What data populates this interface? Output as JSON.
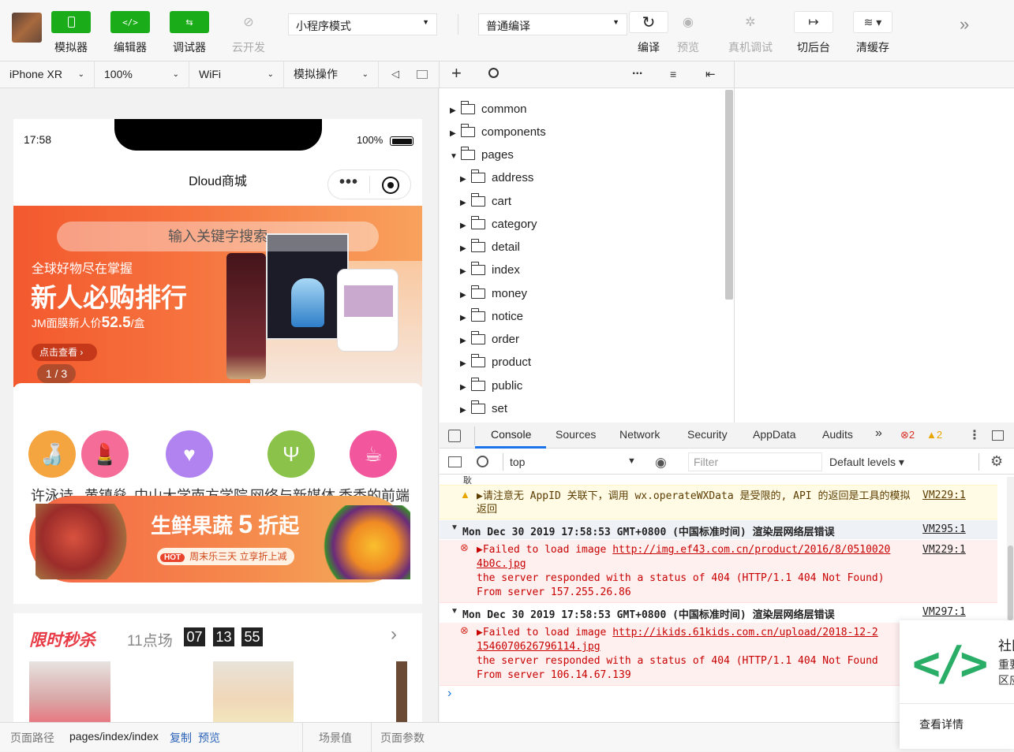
{
  "toolbar": {
    "buttons": [
      {
        "icon": "phone-icon",
        "label": "模拟器"
      },
      {
        "icon": "code-icon",
        "label": "编辑器"
      },
      {
        "icon": "debug-icon",
        "label": "调试器"
      },
      {
        "icon": "cloud-icon",
        "label": "云开发"
      }
    ],
    "mode_select": "小程序模式",
    "compile_select": "普通编译",
    "right_buttons": [
      {
        "icon": "refresh-icon",
        "label": "编译"
      },
      {
        "icon": "eye-icon",
        "label": "预览"
      },
      {
        "icon": "bug-icon",
        "label": "真机调试"
      },
      {
        "icon": "switch-icon",
        "label": "切后台"
      },
      {
        "icon": "layers-icon",
        "label": "清缓存"
      }
    ],
    "more": "»"
  },
  "simbar": {
    "device": "iPhone XR",
    "zoom": "100%",
    "network": "WiFi",
    "sim_ops": "模拟操作"
  },
  "phone": {
    "time": "17:58",
    "battery": "100%",
    "nav_title": "Dloud商城",
    "search_placeholder": "输入关键字搜索",
    "banner": {
      "tag": "全球好物尽在掌握",
      "headline": "新人必购排行",
      "price_prefix": "JM面膜新人价",
      "price": "52.5",
      "price_unit": "/盒",
      "btn": "点击查看",
      "page": "1 / 3"
    },
    "grid": [
      {
        "label": "许泳诗",
        "color": "#f5a540"
      },
      {
        "label": "黄镇燊",
        "color": "#f56c99"
      },
      {
        "label": "中山大学南方学院",
        "color": "#b083f0"
      },
      {
        "label": "网络与新媒体",
        "color": "#8bc34a"
      },
      {
        "label": "香香的前端",
        "color": "#f2579e"
      }
    ],
    "promo": {
      "title_a": "生鲜果蔬",
      "title_num": "5",
      "title_b": "折起",
      "hot": "HOT",
      "sub": "周末乐三天 立享折上减"
    },
    "flash": {
      "title": "限时秒杀",
      "session": "11点场",
      "h": "07",
      "m": "13",
      "s": "55"
    }
  },
  "status": {
    "path_label": "页面路径",
    "path": "pages/index/index",
    "copy": "复制",
    "preview": "预览",
    "scene": "场景值",
    "params": "页面参数"
  },
  "explorer": {
    "toolbar": [
      "+",
      "search-icon",
      "...",
      "sort-icon",
      "collapse-icon"
    ],
    "items": [
      {
        "name": "common",
        "level": 0,
        "open": false
      },
      {
        "name": "components",
        "level": 0,
        "open": false
      },
      {
        "name": "pages",
        "level": 0,
        "open": true
      },
      {
        "name": "address",
        "level": 1,
        "open": false
      },
      {
        "name": "cart",
        "level": 1,
        "open": false
      },
      {
        "name": "category",
        "level": 1,
        "open": false
      },
      {
        "name": "detail",
        "level": 1,
        "open": false
      },
      {
        "name": "index",
        "level": 1,
        "open": false
      },
      {
        "name": "money",
        "level": 1,
        "open": false
      },
      {
        "name": "notice",
        "level": 1,
        "open": false
      },
      {
        "name": "order",
        "level": 1,
        "open": false
      },
      {
        "name": "product",
        "level": 1,
        "open": false
      },
      {
        "name": "public",
        "level": 1,
        "open": false
      },
      {
        "name": "set",
        "level": 1,
        "open": false
      }
    ]
  },
  "devtools": {
    "tabs": [
      "Console",
      "Sources",
      "Network",
      "Security",
      "AppData",
      "Audits"
    ],
    "active_tab": "Console",
    "errors": "2",
    "warnings": "2",
    "context": "top",
    "filter_placeholder": "Filter",
    "levels": "Default levels",
    "messages": {
      "cut": "耿",
      "warn_text": "▶请注意无 AppID 关联下，调用 wx.operateWXData 是受限的, API 的返回是工具的模拟返回",
      "warn_src": "VM229:1",
      "group1_title": "Mon Dec 30 2019 17:58:53 GMT+0800 (中国标准时间) 渲染层网络层错误",
      "group1_src": "VM295:1",
      "err1_prefix": "▶Failed to load image ",
      "err1_url_a": "http://img.ef43.com.cn/product/2016/8/0510020",
      "err1_url_b": "4b0c.jpg",
      "err1_src": "VM229:1",
      "err1_line2": "the server responded with a status of 404 (HTTP/1.1 404 Not Found)",
      "err1_line3": "From server 157.255.26.86",
      "group2_title": "Mon Dec 30 2019 17:58:53 GMT+0800 (中国标准时间) 渲染层网络层错误",
      "group2_src": "VM297:1",
      "err2_prefix": "▶Failed to load image ",
      "err2_url_a": "http://ikids.61kids.com.cn/upload/2018-12-2",
      "err2_url_b": "1546070626796114.jpg",
      "err2_line2": "the server responded with a status of 404 (HTTP/1.1 404 Not Found",
      "err2_line3": "From server 106.14.67.139",
      "prompt": "›"
    }
  },
  "popup": {
    "title_cut": "社区",
    "line1_cut": "重要",
    "line2_cut": "区应",
    "link": "查看详情"
  }
}
